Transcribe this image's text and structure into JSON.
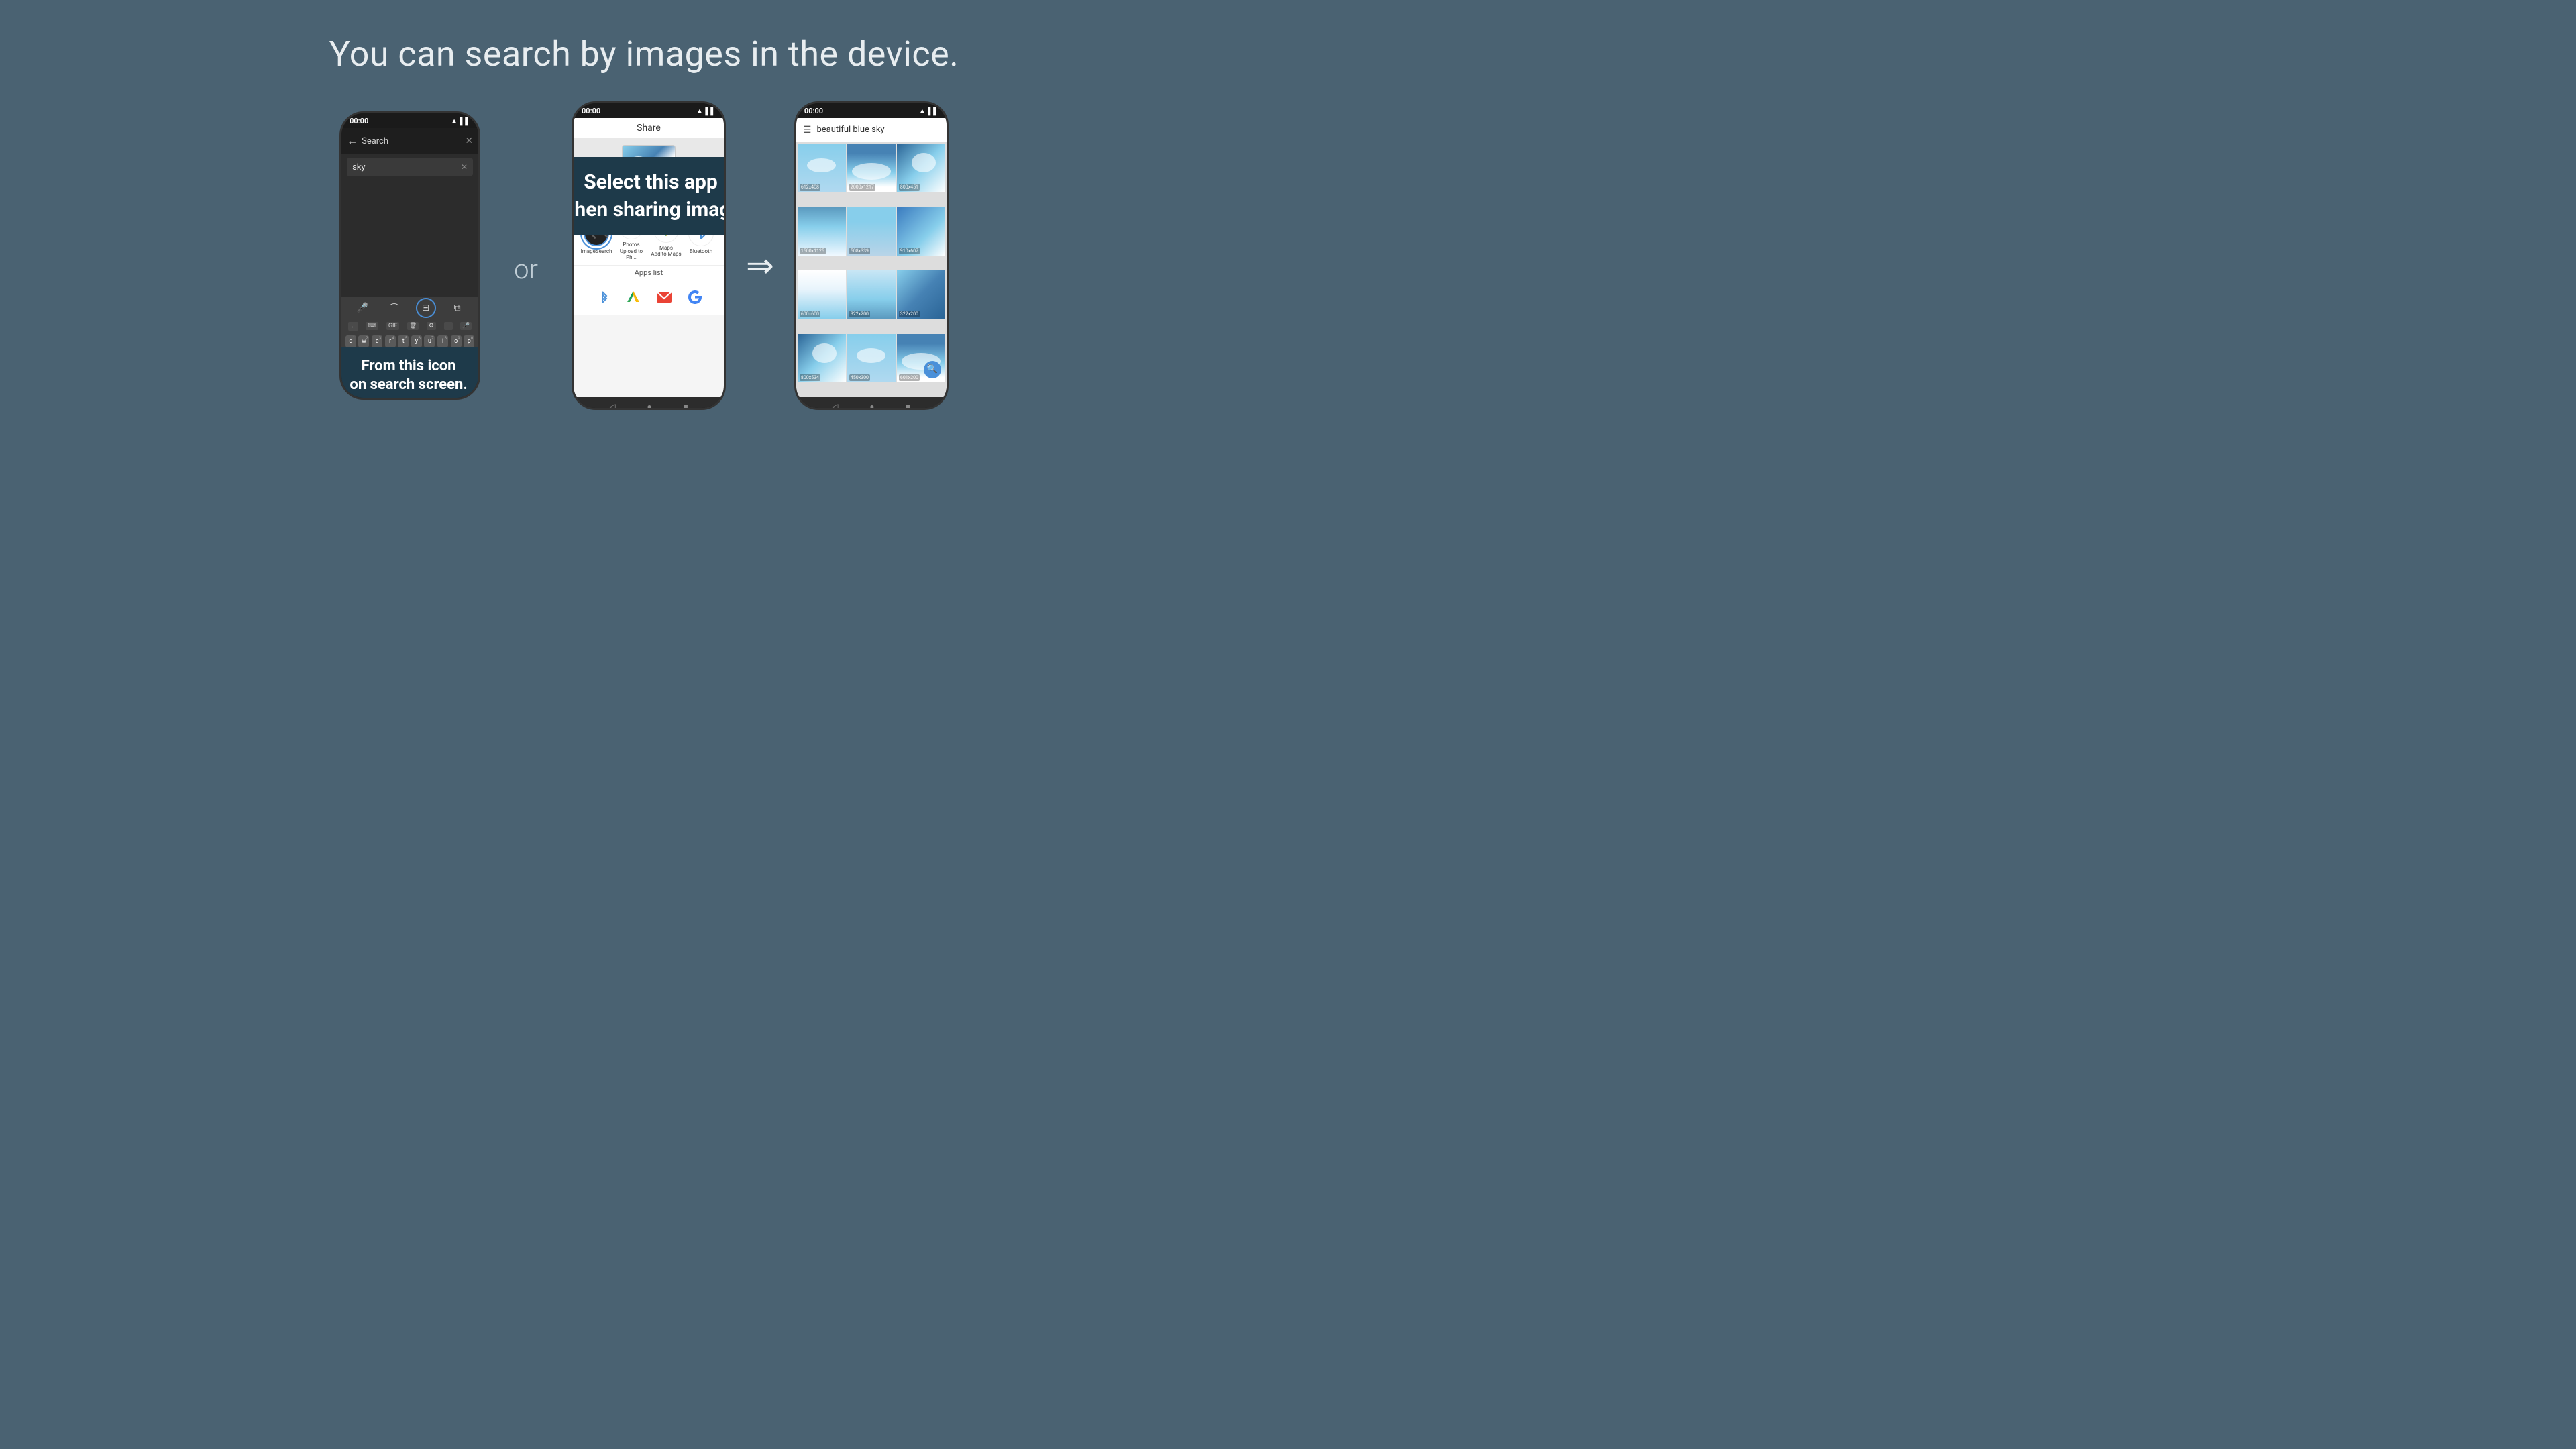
{
  "page": {
    "title": "You can search by images in the device.",
    "background_color": "#4a6272"
  },
  "phone1": {
    "status_time": "00:00",
    "search_placeholder": "Search",
    "query_text": "sky",
    "callout": {
      "line1": "From this icon",
      "line2": "on search screen."
    },
    "keyboard_keys": [
      "q",
      "w",
      "e",
      "r",
      "t",
      "y",
      "u",
      "i",
      "o",
      "p"
    ],
    "key_numbers": [
      "1",
      "2",
      "3",
      "4",
      "5",
      "6",
      "7",
      "8",
      "9",
      "0"
    ]
  },
  "phone2": {
    "status_time": "00:00",
    "share_title": "Share",
    "callout": {
      "line1": "Select this app",
      "line2": "when sharing image"
    },
    "apps": [
      {
        "label": "ImageSearch",
        "type": "image-search"
      },
      {
        "label": "Photos\nUpload to Ph...",
        "type": "photos"
      },
      {
        "label": "Maps\nAdd to Maps",
        "type": "maps"
      },
      {
        "label": "Bluetooth",
        "type": "bluetooth"
      }
    ],
    "apps_list_label": "Apps list"
  },
  "phone3": {
    "status_time": "00:00",
    "search_query": "beautiful blue sky",
    "grid_items": [
      {
        "label": "612x408",
        "sky_class": "sky-1"
      },
      {
        "label": "2000x1217",
        "sky_class": "sky-2"
      },
      {
        "label": "800x451",
        "sky_class": "sky-3"
      },
      {
        "label": "1500x1125",
        "sky_class": "sky-4"
      },
      {
        "label": "508x339",
        "sky_class": "sky-5"
      },
      {
        "label": "910x607",
        "sky_class": "sky-6"
      },
      {
        "label": "600x600",
        "sky_class": "sky-7"
      },
      {
        "label": "322x200",
        "sky_class": "sky-8"
      },
      {
        "label": "322x200",
        "sky_class": "sky-9"
      },
      {
        "label": "800x534",
        "sky_class": "sky-1"
      },
      {
        "label": "450x300",
        "sky_class": "sky-2"
      },
      {
        "label": "601x200",
        "sky_class": "sky-3"
      }
    ]
  },
  "icons": {
    "back_arrow": "←",
    "close_x": "✕",
    "mic": "🎤",
    "trend": "⌒",
    "image_icon": "⊟",
    "copy": "⧉",
    "backspace": "⌫",
    "gif": "GIF",
    "delete": "🗑",
    "settings_key": "⚙",
    "more_dots": "···",
    "arrow_right": "⇒",
    "down_arrow": "▼",
    "circle": "●",
    "square": "■",
    "hamburger": "☰",
    "search": "🔍",
    "bluetooth": "✦"
  }
}
